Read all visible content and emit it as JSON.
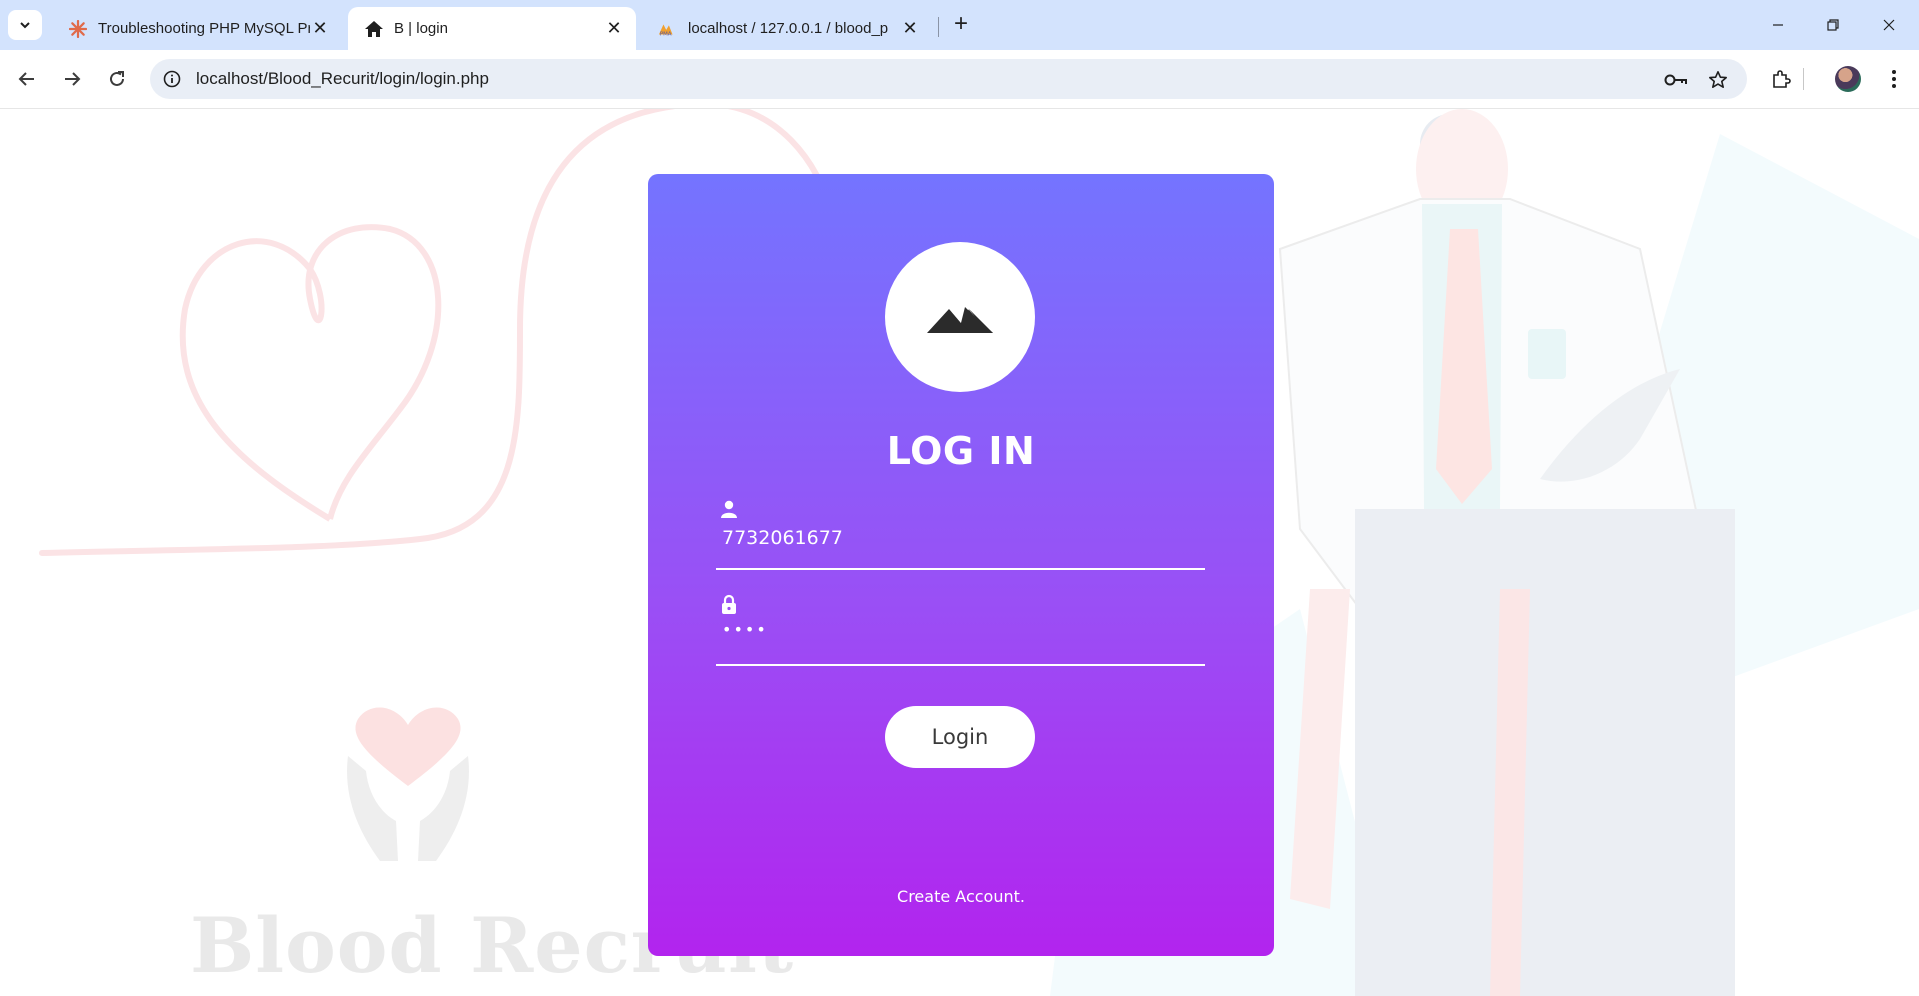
{
  "browser": {
    "tabs": [
      {
        "title": "Troubleshooting PHP MySQL Pr",
        "icon": "asterisk-favicon-icon",
        "active": false
      },
      {
        "title": "B | login",
        "icon": "home-icon",
        "active": true
      },
      {
        "title": "localhost / 127.0.0.1 / blood_p",
        "icon": "phpmyadmin-favicon-icon",
        "active": false
      }
    ],
    "new_tab_label": "+",
    "address": "localhost/Blood_Recurit/login/login.php"
  },
  "background": {
    "watermark_text": "Blood Recruit"
  },
  "login": {
    "title": "LOG IN",
    "username_value": "7732061677",
    "password_masked": "••••",
    "submit_label": "Login",
    "create_account_label": "Create Account."
  },
  "colors": {
    "card_top": "#7474ff",
    "card_bottom": "#b224ee",
    "tabstrip": "#d3e3fd"
  }
}
